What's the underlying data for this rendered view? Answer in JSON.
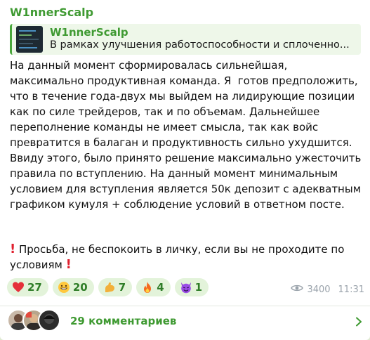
{
  "post": {
    "sender": "W1nnerScalp",
    "reply": {
      "title": "W1nnerScalp",
      "preview": "В рамках улучшения работоспособности и сплоченно..."
    },
    "body": "На данный момент сформировалась сильнейшая, максимально продуктивная команда. Я  готов предположить, что в течение года-двух мы выйдем на лидирующие позиции как по силе трейдеров, так и по объемам. Дальнейшее переполнение команды не имеет смысла, так как войс превратится в балаган и продуктивность сильно ухудшится. Ввиду этого, было принято решение максимально ужесточить правила по вступлению. На данный момент минимальным условием для вступления является 50к депозит с адекватным графиком кумуля + соблюдение условий в ответном посте.",
    "notice": "Просьба, не беспокоить в личку, если вы не проходите по условиям"
  },
  "reactions": [
    {
      "icon": "heart-icon",
      "count": "27"
    },
    {
      "icon": "grinning-face-icon",
      "count": "20"
    },
    {
      "icon": "flexed-biceps-icon",
      "count": "7"
    },
    {
      "icon": "fire-icon",
      "count": "4"
    },
    {
      "icon": "smiling-devil-icon",
      "count": "1"
    }
  ],
  "meta": {
    "views": "3400",
    "time": "11:31"
  },
  "comments": {
    "label": "29 комментариев"
  },
  "colors": {
    "accent": "#3f9a32",
    "reaction_bg": "#e3f3da",
    "warning": "#e0202f"
  }
}
